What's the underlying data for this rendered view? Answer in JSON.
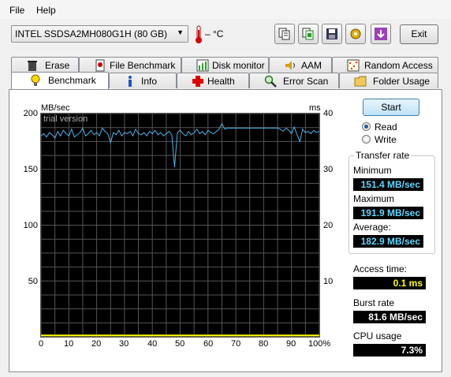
{
  "menu": {
    "file": "File",
    "help": "Help"
  },
  "toolbar": {
    "drive": "INTEL SSDSA2MH080G1H (80 GB)",
    "temperature": "– °C",
    "buttons": [
      "copy-text-icon",
      "copy-info-icon",
      "save-icon",
      "gear-icon",
      "download-icon"
    ],
    "exit_label": "Exit"
  },
  "tabs": {
    "top_row": [
      {
        "label": "Erase",
        "icon": "trash-icon"
      },
      {
        "label": "File Benchmark",
        "icon": "file-benchmark-icon"
      },
      {
        "label": "Disk monitor",
        "icon": "disk-monitor-icon"
      },
      {
        "label": "AAM",
        "icon": "speaker-icon"
      },
      {
        "label": "Random Access",
        "icon": "random-access-icon"
      }
    ],
    "bottom_row": [
      {
        "label": "Benchmark",
        "icon": "bulb-icon",
        "active": true
      },
      {
        "label": "Info",
        "icon": "info-icon"
      },
      {
        "label": "Health",
        "icon": "health-cross-icon"
      },
      {
        "label": "Error Scan",
        "icon": "magnifier-icon"
      },
      {
        "label": "Folder Usage",
        "icon": "folder-icon"
      }
    ]
  },
  "benchmark": {
    "start_label": "Start",
    "mode_options": [
      "Read",
      "Write"
    ],
    "mode_selected": "Read",
    "transfer_rate_title": "Transfer rate",
    "minimum_label": "Minimum",
    "minimum_value": "151.4 MB/sec",
    "maximum_label": "Maximum",
    "maximum_value": "191.9 MB/sec",
    "average_label": "Average:",
    "average_value": "182.9 MB/sec",
    "access_time_label": "Access time:",
    "access_time_value": "0.1 ms",
    "burst_rate_label": "Burst rate",
    "burst_rate_value": "81.6 MB/sec",
    "cpu_usage_label": "CPU usage",
    "cpu_usage_value": "7.3%"
  },
  "graph": {
    "watermark": "trial version",
    "y_left_unit": "MB/sec",
    "y_right_unit": "ms",
    "y_left_ticks": [
      "200",
      "150",
      "100",
      "50"
    ],
    "y_right_ticks": [
      "40",
      "30",
      "20",
      "10"
    ],
    "x_ticks": [
      "0",
      "10",
      "20",
      "30",
      "40",
      "50",
      "60",
      "70",
      "80",
      "90",
      "100%"
    ],
    "colors": {
      "transfer": "#4fb3e8",
      "access": "#ffff00",
      "grid": "#555555"
    }
  },
  "chart_data": {
    "type": "line",
    "xlim": [
      0,
      100
    ],
    "ylim": [
      0,
      200
    ],
    "y2lim": [
      0,
      40
    ],
    "xlabel": "",
    "ylabel": "MB/sec",
    "y2label": "ms",
    "series": [
      {
        "x": [
          0,
          1,
          2,
          3,
          4,
          5,
          6,
          7,
          8,
          9,
          10,
          11,
          12,
          13,
          14,
          15,
          16,
          17,
          18,
          19,
          20,
          21,
          22,
          23,
          24,
          25,
          26,
          27,
          28,
          29,
          30,
          31,
          32,
          33,
          34,
          35,
          36,
          37,
          38,
          39,
          40,
          41,
          42,
          43,
          44,
          45,
          46,
          47,
          48,
          49,
          50,
          51,
          52,
          53,
          54,
          55,
          56,
          57,
          58,
          59,
          60,
          61,
          62,
          63,
          64,
          65,
          66,
          67,
          68,
          69,
          70,
          71,
          72,
          73,
          74,
          75,
          76,
          77,
          78,
          79,
          80,
          81,
          82,
          83,
          84,
          85,
          86,
          87,
          88,
          89,
          90,
          91,
          92,
          93,
          94,
          95,
          96,
          97,
          98,
          99,
          100
        ],
        "y": [
          180,
          182,
          179,
          183,
          181,
          178,
          184,
          180,
          185,
          182,
          180,
          186,
          179,
          181,
          183,
          187,
          180,
          182,
          185,
          181,
          183,
          180,
          187,
          184,
          182,
          174,
          183,
          181,
          185,
          180,
          183,
          182,
          184,
          180,
          186,
          182,
          181,
          183,
          180,
          184,
          182,
          185,
          181,
          183,
          180,
          182,
          184,
          181,
          152,
          183,
          185,
          182,
          180,
          184,
          181,
          183,
          186,
          182,
          184,
          181,
          185,
          183,
          182,
          184,
          186,
          191,
          186,
          187,
          187,
          187,
          187,
          187,
          187,
          187,
          187,
          187,
          187,
          187,
          187,
          187,
          187,
          187,
          187,
          187,
          187,
          187,
          186,
          184,
          187,
          185,
          182,
          188,
          181,
          175,
          186,
          183,
          184,
          182,
          185,
          183,
          184
        ]
      },
      {
        "x": [
          0,
          100
        ],
        "y2": [
          0.1,
          0.1
        ]
      }
    ]
  }
}
